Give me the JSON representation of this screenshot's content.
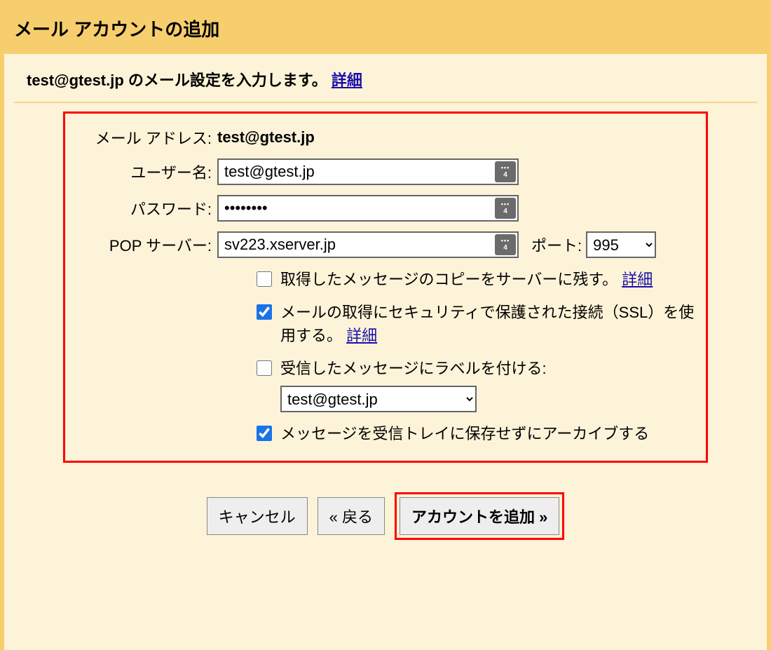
{
  "header": {
    "title": "メール アカウントの追加"
  },
  "subhead": {
    "text_prefix": "test@gtest.jp のメール設定を入力します。",
    "details_link": "詳細"
  },
  "form": {
    "email_label": "メール アドレス:",
    "email_value": "test@gtest.jp",
    "username_label": "ユーザー名:",
    "username_value": "test@gtest.jp",
    "password_label": "パスワード:",
    "password_value": "••••••••",
    "pop_label": "POP サーバー:",
    "pop_value": "sv223.xserver.jp",
    "port_label": "ポート:",
    "port_value": "995",
    "checkbox_leave_copy": "取得したメッセージのコピーをサーバーに残す。",
    "checkbox_ssl": "メールの取得にセキュリティで保護された接続（SSL）を使用する。",
    "checkbox_label_prefix": "受信したメッセージにラベルを付ける:",
    "label_select_value": "test@gtest.jp",
    "checkbox_archive": "メッセージを受信トレイに保存せずにアーカイブする",
    "details_link": "詳細"
  },
  "buttons": {
    "cancel": "キャンセル",
    "back": "« 戻る",
    "add": "アカウントを追加 »"
  }
}
